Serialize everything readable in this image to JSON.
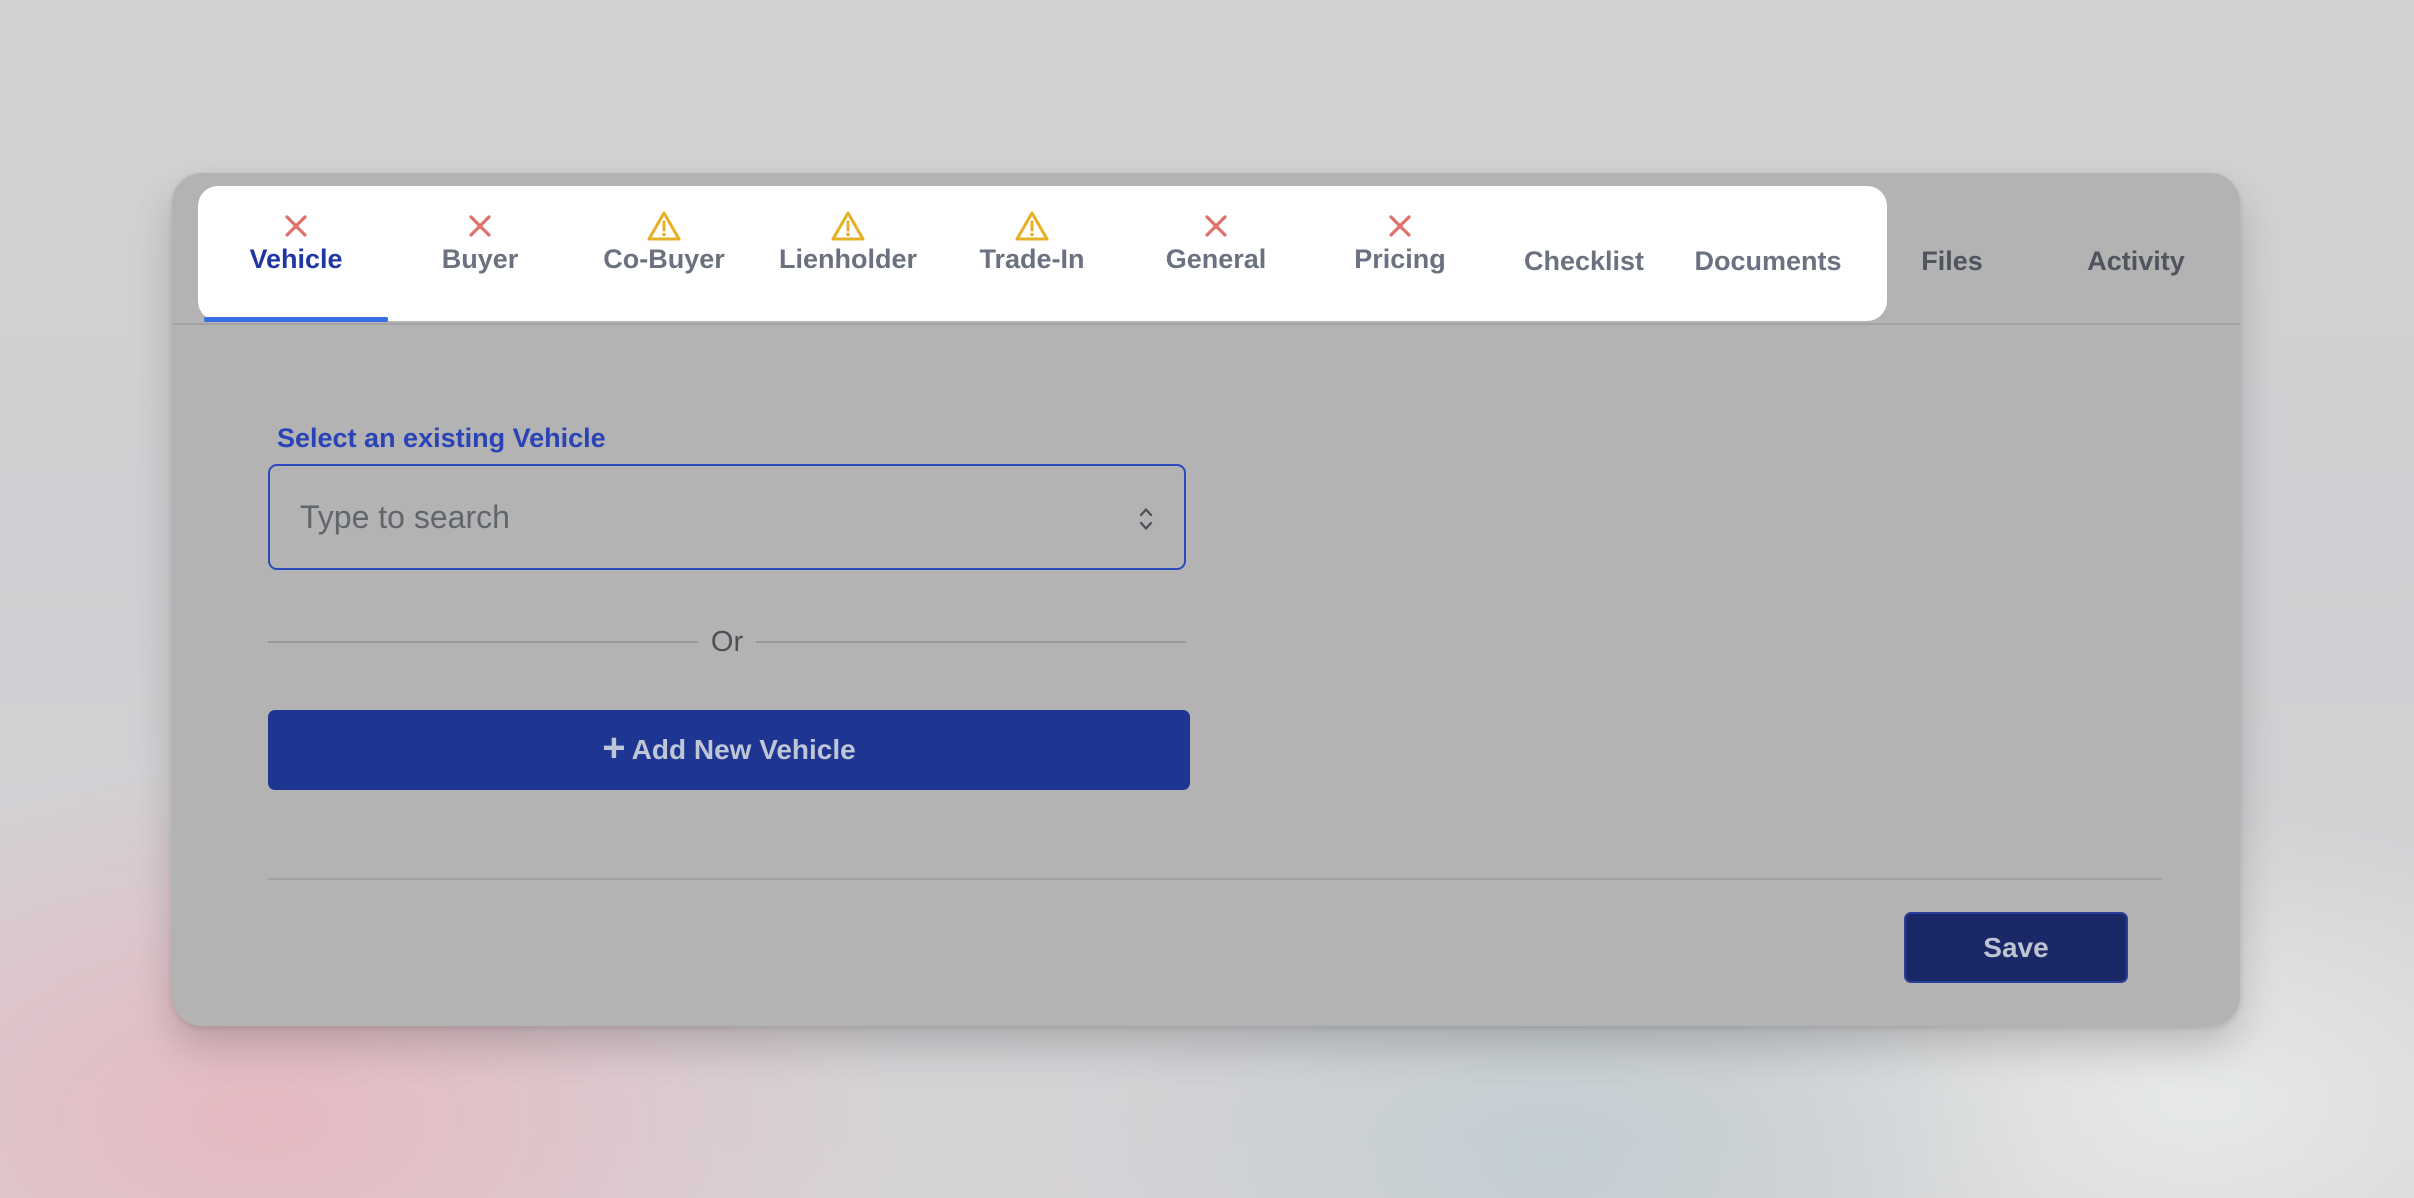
{
  "tabs": [
    {
      "label": "Vehicle",
      "status": "error",
      "icon": "x-icon",
      "active": true
    },
    {
      "label": "Buyer",
      "status": "error",
      "icon": "x-icon"
    },
    {
      "label": "Co-Buyer",
      "status": "warning",
      "icon": "warning-icon"
    },
    {
      "label": "Lienholder",
      "status": "warning",
      "icon": "warning-icon"
    },
    {
      "label": "Trade-In",
      "status": "warning",
      "icon": "warning-icon"
    },
    {
      "label": "General",
      "status": "error",
      "icon": "x-icon"
    },
    {
      "label": "Pricing",
      "status": "error",
      "icon": "x-icon"
    },
    {
      "label": "Checklist"
    },
    {
      "label": "Documents"
    },
    {
      "label": "Files"
    },
    {
      "label": "Activity"
    }
  ],
  "vehicle_form": {
    "select_label": "Select an existing Vehicle",
    "search_placeholder": "Type to search",
    "divider_text": "Or",
    "add_button_label": "Add New Vehicle"
  },
  "footer": {
    "save_label": "Save"
  },
  "colors": {
    "error": "#e0706a",
    "warning": "#e5b025",
    "active": "#1f37a4",
    "accent_underline": "#3a6ce6",
    "primary_button": "#1e3692",
    "save_button": "#1b2868"
  }
}
